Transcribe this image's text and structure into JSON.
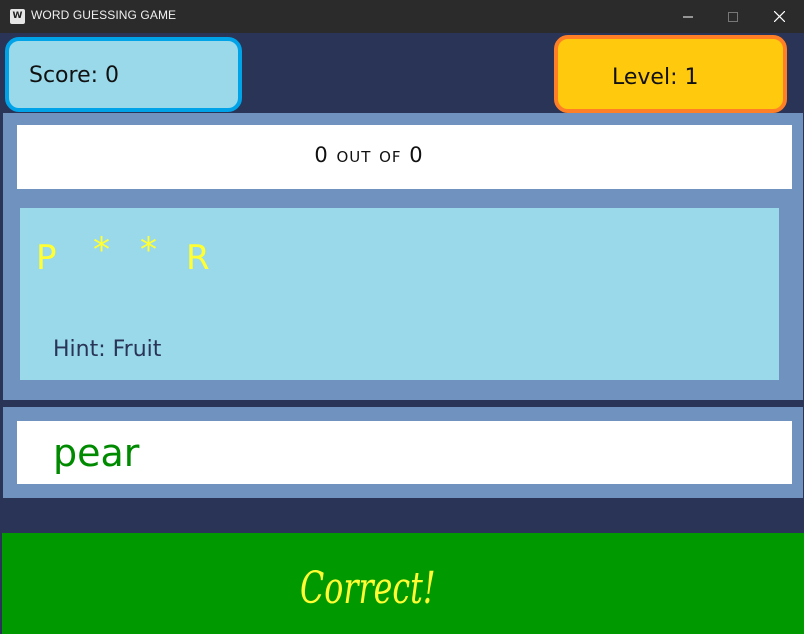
{
  "window": {
    "title": "WORD GUESSING GAME",
    "icon_letter": "W"
  },
  "score": {
    "label": "Score: 0"
  },
  "level": {
    "label": "Level: 1"
  },
  "progress": {
    "label": "0 out of 0"
  },
  "puzzle": {
    "letters": [
      "P",
      "*",
      "*",
      "R"
    ],
    "hint": "Hint: Fruit"
  },
  "answer": {
    "value": "pear"
  },
  "feedback": {
    "message": "Correct!"
  },
  "colors": {
    "background": "#2a3457",
    "score_fill": "#99d9ea",
    "score_border": "#00a2e8",
    "level_fill": "#ffc90e",
    "level_border": "#ff7f27",
    "panel": "#7092be",
    "letter": "#ffff33",
    "answer_text": "#008a00",
    "feedback_fill": "#009a00"
  }
}
